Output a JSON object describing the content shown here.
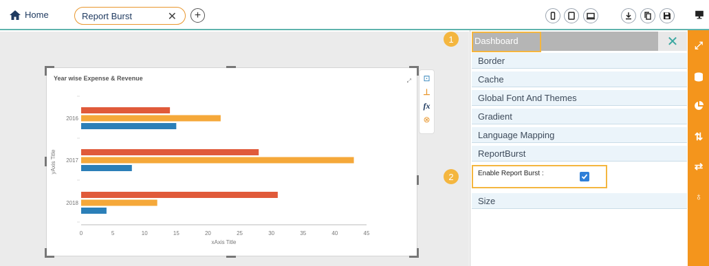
{
  "topbar": {
    "home_label": "Home",
    "tab_label": "Report Burst",
    "tab_close": "✕",
    "add_tab": "+"
  },
  "colors": {
    "accent": "#f4951c",
    "highlight": "#f4b63f",
    "teal": "#3aa7a0",
    "bar_red": "#e05a3a",
    "bar_orange": "#f5a83a",
    "bar_blue": "#2b7fb8"
  },
  "toolbar_icons": [
    "mobile-icon",
    "tablet-icon",
    "desktop-icon",
    "download-icon",
    "copy-icon",
    "save-icon",
    "monitor-icon"
  ],
  "panel": {
    "header_label": "Dashboard",
    "close_label": "✕",
    "sections": [
      "Border",
      "Cache",
      "Global Font And Themes",
      "Gradient",
      "Language Mapping",
      "ReportBurst",
      "Size"
    ],
    "enable_label": "Enable Report Burst :",
    "enable_checked": true,
    "badges": [
      "1",
      "2"
    ]
  },
  "chart_tools": [
    "properties-icon",
    "axis-icon",
    "fx-icon",
    "remove-icon"
  ],
  "right_rail_icons": [
    "expand-icon",
    "database-icon",
    "pie-chart-icon",
    "sort-icon",
    "exchange-icon",
    "bulb-icon"
  ],
  "chart_data": {
    "type": "bar",
    "orientation": "horizontal",
    "title": "Year wise Expense & Revenue",
    "xlabel": "xAxis Title",
    "ylabel": "yAxis Title",
    "categories": [
      "2016",
      "2017",
      "2018"
    ],
    "series": [
      {
        "values": [
          14,
          28,
          31
        ],
        "color": "#e05a3a"
      },
      {
        "values": [
          22,
          43,
          12
        ],
        "color": "#f5a83a"
      },
      {
        "values": [
          15,
          8,
          4
        ],
        "color": "#2b7fb8"
      }
    ],
    "xlim": [
      0,
      45
    ],
    "xticks": [
      "0",
      "5",
      "10",
      "15",
      "20",
      "25",
      "30",
      "35",
      "40",
      "45"
    ],
    "grid": false,
    "legend": "none"
  }
}
